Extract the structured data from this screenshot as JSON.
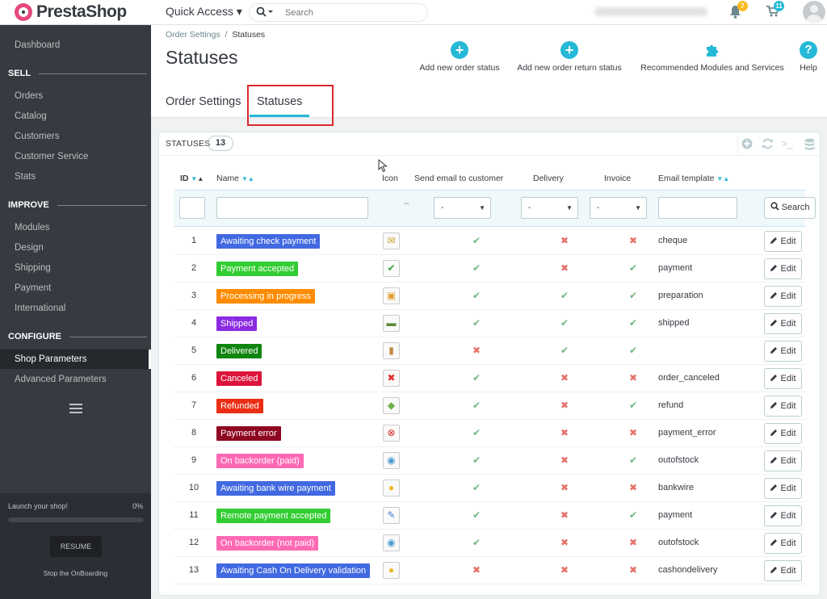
{
  "header": {
    "logo_text": "PrestaShop",
    "quick_access": "Quick Access ▾",
    "search_placeholder": "Search",
    "notifications_count": "7",
    "orders_count": "11"
  },
  "sidebar": {
    "dashboard": "Dashboard",
    "sections": [
      {
        "title": "SELL",
        "items": [
          "Orders",
          "Catalog",
          "Customers",
          "Customer Service",
          "Stats"
        ]
      },
      {
        "title": "IMPROVE",
        "items": [
          "Modules",
          "Design",
          "Shipping",
          "Payment",
          "International"
        ]
      },
      {
        "title": "CONFIGURE",
        "items": [
          "Shop Parameters",
          "Advanced Parameters"
        ]
      }
    ],
    "active_item": "Shop Parameters",
    "onboarding": {
      "launch": "Launch your shop!",
      "percent": "0%",
      "progress": 0,
      "resume": "RESUME",
      "stop": "Stop the OnBoarding"
    }
  },
  "page": {
    "breadcrumb_parent": "Order Settings",
    "breadcrumb_sep": "/",
    "breadcrumb_current": "Statuses",
    "title": "Statuses",
    "toolbar": {
      "add_order_status": "Add new order status",
      "add_return_status": "Add new order return status",
      "recommended": "Recommended Modules and Services",
      "help": "Help"
    },
    "tabs": [
      "Order Settings",
      "Statuses"
    ],
    "active_tab": "Statuses"
  },
  "panel": {
    "title": "STATUSES",
    "count": "13",
    "columns": {
      "id": "ID",
      "name": "Name",
      "icon": "Icon",
      "send_email": "Send email to customer",
      "delivery": "Delivery",
      "invoice": "Invoice",
      "email_template": "Email template"
    },
    "filter": {
      "icon_placeholder": "--",
      "select_value": "-",
      "search_button": "Search"
    },
    "edit_label": "Edit",
    "colors": {
      "yes": "#70b580",
      "no": "#e5726a",
      "accent": "#25b9d7"
    },
    "rows": [
      {
        "id": "1",
        "name": "Awaiting check payment",
        "color": "#4169e1",
        "icon": "cheque-icon",
        "glyph": "✉",
        "glyph_color": "#c9a227",
        "email": true,
        "delivery": false,
        "invoice": false,
        "template": "cheque"
      },
      {
        "id": "2",
        "name": "Payment accepted",
        "color": "#32cd32",
        "icon": "check-icon",
        "glyph": "✔",
        "glyph_color": "#3a9d3a",
        "email": true,
        "delivery": false,
        "invoice": true,
        "template": "payment"
      },
      {
        "id": "3",
        "name": "Processing in progress",
        "color": "#ff8c00",
        "icon": "package-icon",
        "glyph": "▣",
        "glyph_color": "#e0a030",
        "email": true,
        "delivery": true,
        "invoice": true,
        "template": "preparation"
      },
      {
        "id": "4",
        "name": "Shipped",
        "color": "#8a2be2",
        "icon": "truck-icon",
        "glyph": "▬",
        "glyph_color": "#5b8a3a",
        "email": true,
        "delivery": true,
        "invoice": true,
        "template": "shipped"
      },
      {
        "id": "5",
        "name": "Delivered",
        "color": "#108510",
        "icon": "box-icon",
        "glyph": "▮",
        "glyph_color": "#c08a40",
        "email": false,
        "delivery": true,
        "invoice": true,
        "template": ""
      },
      {
        "id": "6",
        "name": "Canceled",
        "color": "#dc143c",
        "icon": "cross-icon",
        "glyph": "✖",
        "glyph_color": "#e03030",
        "email": true,
        "delivery": false,
        "invoice": false,
        "template": "order_canceled"
      },
      {
        "id": "7",
        "name": "Refunded",
        "color": "#ec2e15",
        "icon": "money-icon",
        "glyph": "◆",
        "glyph_color": "#6ab04c",
        "email": true,
        "delivery": false,
        "invoice": true,
        "template": "refund"
      },
      {
        "id": "8",
        "name": "Payment error",
        "color": "#8f0621",
        "icon": "error-icon",
        "glyph": "⊗",
        "glyph_color": "#d92020",
        "email": true,
        "delivery": false,
        "invoice": false,
        "template": "payment_error"
      },
      {
        "id": "9",
        "name": "On backorder (paid)",
        "color": "#ff69b4",
        "icon": "backorder-icon",
        "glyph": "◉",
        "glyph_color": "#4a9ad0",
        "email": true,
        "delivery": false,
        "invoice": true,
        "template": "outofstock"
      },
      {
        "id": "10",
        "name": "Awaiting bank wire payment",
        "color": "#4169e1",
        "icon": "coins-icon",
        "glyph": "●",
        "glyph_color": "#e8b820",
        "email": true,
        "delivery": false,
        "invoice": false,
        "template": "bankwire"
      },
      {
        "id": "11",
        "name": "Remote payment accepted",
        "color": "#32cd32",
        "icon": "pen-icon",
        "glyph": "✎",
        "glyph_color": "#4a7ad0",
        "email": true,
        "delivery": false,
        "invoice": true,
        "template": "payment"
      },
      {
        "id": "12",
        "name": "On backorder (not paid)",
        "color": "#ff69b4",
        "icon": "backorder-icon",
        "glyph": "◉",
        "glyph_color": "#4a9ad0",
        "email": true,
        "delivery": false,
        "invoice": false,
        "template": "outofstock"
      },
      {
        "id": "13",
        "name": "Awaiting Cash On Delivery validation",
        "color": "#4169e1",
        "icon": "coins-icon",
        "glyph": "●",
        "glyph_color": "#e8b820",
        "email": false,
        "delivery": false,
        "invoice": false,
        "template": "cashondelivery"
      }
    ]
  }
}
